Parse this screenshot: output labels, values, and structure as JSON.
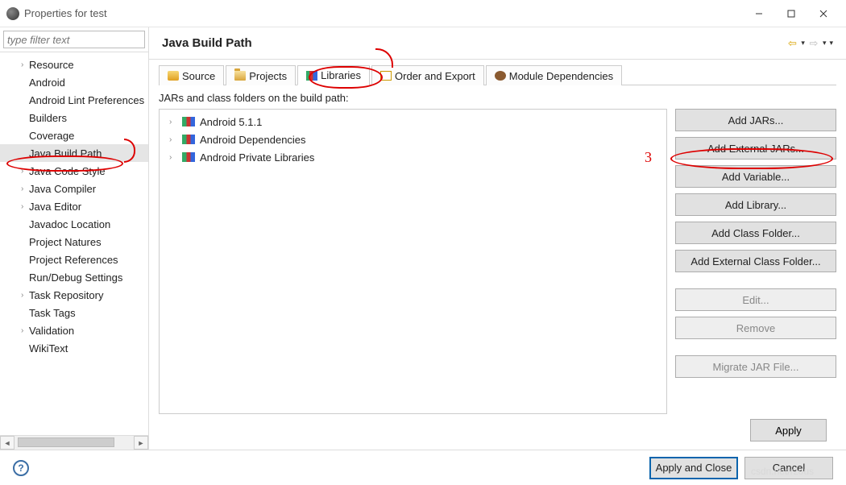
{
  "window": {
    "title": "Properties for test"
  },
  "filter": {
    "placeholder": "type filter text"
  },
  "sidebar": {
    "items": [
      {
        "label": "Resource",
        "expandable": true
      },
      {
        "label": "Android",
        "expandable": false
      },
      {
        "label": "Android Lint Preferences",
        "expandable": false
      },
      {
        "label": "Builders",
        "expandable": false
      },
      {
        "label": "Coverage",
        "expandable": false
      },
      {
        "label": "Java Build Path",
        "expandable": false,
        "selected": true
      },
      {
        "label": "Java Code Style",
        "expandable": true
      },
      {
        "label": "Java Compiler",
        "expandable": true
      },
      {
        "label": "Java Editor",
        "expandable": true
      },
      {
        "label": "Javadoc Location",
        "expandable": false
      },
      {
        "label": "Project Natures",
        "expandable": false
      },
      {
        "label": "Project References",
        "expandable": false
      },
      {
        "label": "Run/Debug Settings",
        "expandable": false
      },
      {
        "label": "Task Repository",
        "expandable": true
      },
      {
        "label": "Task Tags",
        "expandable": false
      },
      {
        "label": "Validation",
        "expandable": true
      },
      {
        "label": "WikiText",
        "expandable": false
      }
    ]
  },
  "page": {
    "title": "Java Build Path",
    "tabs": [
      {
        "label": "Source",
        "icon": "source"
      },
      {
        "label": "Projects",
        "icon": "project"
      },
      {
        "label": "Libraries",
        "icon": "libraries",
        "active": true
      },
      {
        "label": "Order and Export",
        "icon": "order"
      },
      {
        "label": "Module Dependencies",
        "icon": "module"
      }
    ],
    "desc": "JARs and class folders on the build path:",
    "libs": [
      {
        "label": "Android 5.1.1"
      },
      {
        "label": "Android Dependencies"
      },
      {
        "label": "Android Private Libraries"
      }
    ],
    "buttons": {
      "add_jars": "Add JARs...",
      "add_ext_jars": "Add External JARs...",
      "add_var": "Add Variable...",
      "add_lib": "Add Library...",
      "add_cf": "Add Class Folder...",
      "add_ext_cf": "Add External Class Folder...",
      "edit": "Edit...",
      "remove": "Remove",
      "migrate": "Migrate JAR File..."
    },
    "apply": "Apply"
  },
  "footer": {
    "apply_close": "Apply and Close",
    "cancel": "Cancel"
  },
  "annotations": {
    "mark3": "3"
  },
  "watermark": "csdn.net/rzous"
}
